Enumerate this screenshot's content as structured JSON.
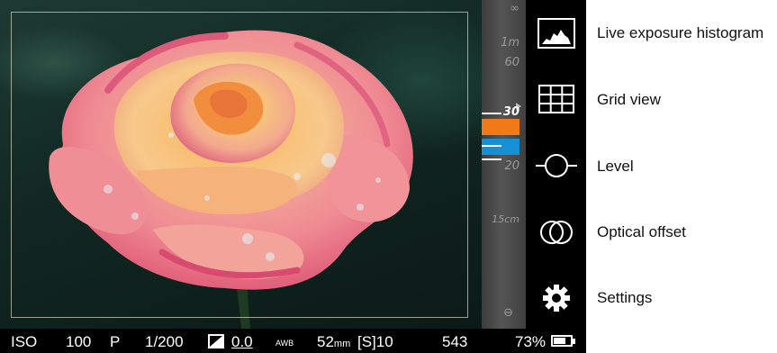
{
  "viewfinder": {
    "subject": "rose-image"
  },
  "focus_scale": {
    "infinity": "∞",
    "one_meter": "1m",
    "sixty": "60",
    "thirty": "30",
    "twenty": "20",
    "fifteen_cm": "15cm",
    "near_limit_symbol": "⊖",
    "orange_color": "#f07a18",
    "blue_color": "#1590d4"
  },
  "side_icons": [
    {
      "icon": "histogram-icon"
    },
    {
      "icon": "grid-icon"
    },
    {
      "icon": "level-icon"
    },
    {
      "icon": "optical-offset-icon"
    },
    {
      "icon": "gear-icon"
    }
  ],
  "callouts": {
    "histogram": "Live exposure histogram",
    "grid": "Grid view",
    "level": "Level",
    "optical_offset": "Optical offset",
    "settings": "Settings"
  },
  "status_bar": {
    "iso_label": "ISO",
    "iso_value": "100",
    "mode": "P",
    "shutter": "1/200",
    "ev_value": "0.0",
    "wb": "AWB",
    "focal_value": "52",
    "focal_unit": "mm",
    "focus_mode": "[S]10",
    "shots_remaining": "543",
    "battery_percent_text": "73%",
    "battery_level": 0.73
  }
}
